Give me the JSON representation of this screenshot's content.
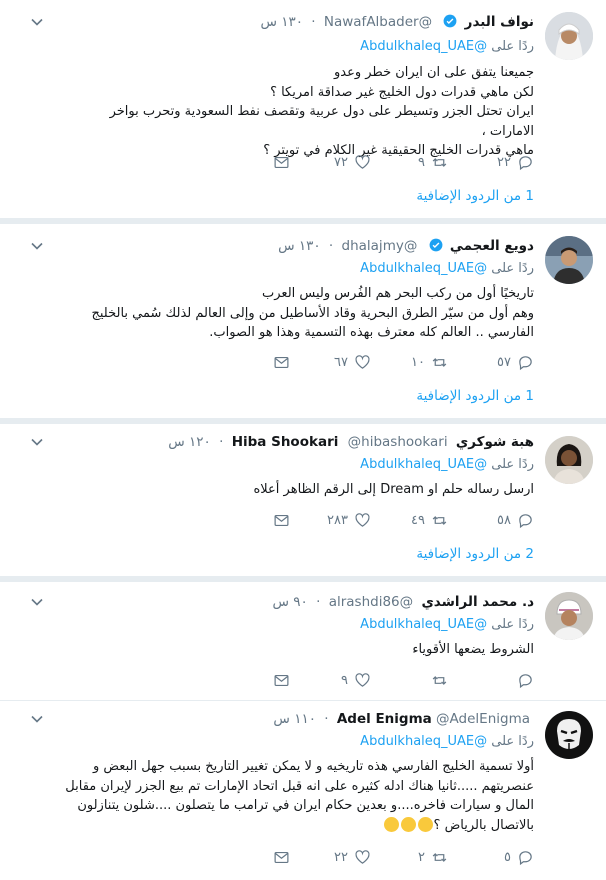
{
  "reply_prefix": "ردًا على",
  "reply_target": "@Abdulkhaleq_UAE",
  "tweets": [
    {
      "name": "نواف البدر",
      "handle": "@NawafAlbader",
      "time": "١٣٠ س",
      "verified": true,
      "body": "جميعنا يتفق على ان ايران خطر وعدو\nلكن ماهي قدرات دول الخليج غير صداقة امريكا ؟\nايران تحتل الجزر وتسيطر على دول عربية وتقصف نفط السعودية وتحرب بواخر الامارات ،\nماهي قدرات الخليج الحقيقية غير الكلام في تويتر ؟",
      "replies": "٢٢",
      "retweets": "٩",
      "likes": "٧٢",
      "more": "1 من الردود الإضافية"
    },
    {
      "name": "دويع العجمي",
      "handle": "@dhalajmy",
      "time": "١٣٠ س",
      "verified": true,
      "body": "تاريخيًا أول من ركب البحر هم الفُرس وليس العرب\nوهم أول من سيّر الطرق البحرية وقاد الأساطيل من وإلى العالم لذلك سُمي بالخليج\nالفارسي .. العالم كله معترف بهذه التسمية وهذا هو الصواب.",
      "replies": "٥٧",
      "retweets": "١٠",
      "likes": "٦٧",
      "more": "1 من الردود الإضافية"
    },
    {
      "name": "هبة شوكري",
      "name2": "Hiba Shookari",
      "handle": "@hibashookari",
      "time": "١٢٠ س",
      "verified": false,
      "body": "ارسل رساله حلم او Dream إلى الرقم الظاهر أعلاه",
      "replies": "٥٨",
      "retweets": "٤٩",
      "likes": "٢٨٣",
      "more": "2 من الردود الإضافية"
    },
    {
      "name": "د. محمد الراشدي",
      "handle": "@alrashdi86",
      "time": "٩٠ س",
      "verified": false,
      "body": "الشروط يضعها الأقوياء",
      "replies": "",
      "retweets": "",
      "likes": "٩"
    },
    {
      "name": "Adel Enigma",
      "handle": "@AdelEnigma",
      "time": "١١٠ س",
      "verified": false,
      "body": "أولا تسمية الخليج الفارسي هذه تاريخيه و لا يمكن تغيير التاريخ بسبب جهل البعض و\nعنصريتهم .....ثانيا هناك ادله كثيره على انه قبل اتحاد الإمارات تم بيع الجزر لإيران مقابل\nالمال و سيارات فاخره....و بعدين حكام ايران في ترامب ما يتصلون ....شلون يتنازلون\nبالاتصال بالرياض ؟",
      "replies": "٥",
      "retweets": "٢",
      "likes": "٢٢"
    }
  ]
}
